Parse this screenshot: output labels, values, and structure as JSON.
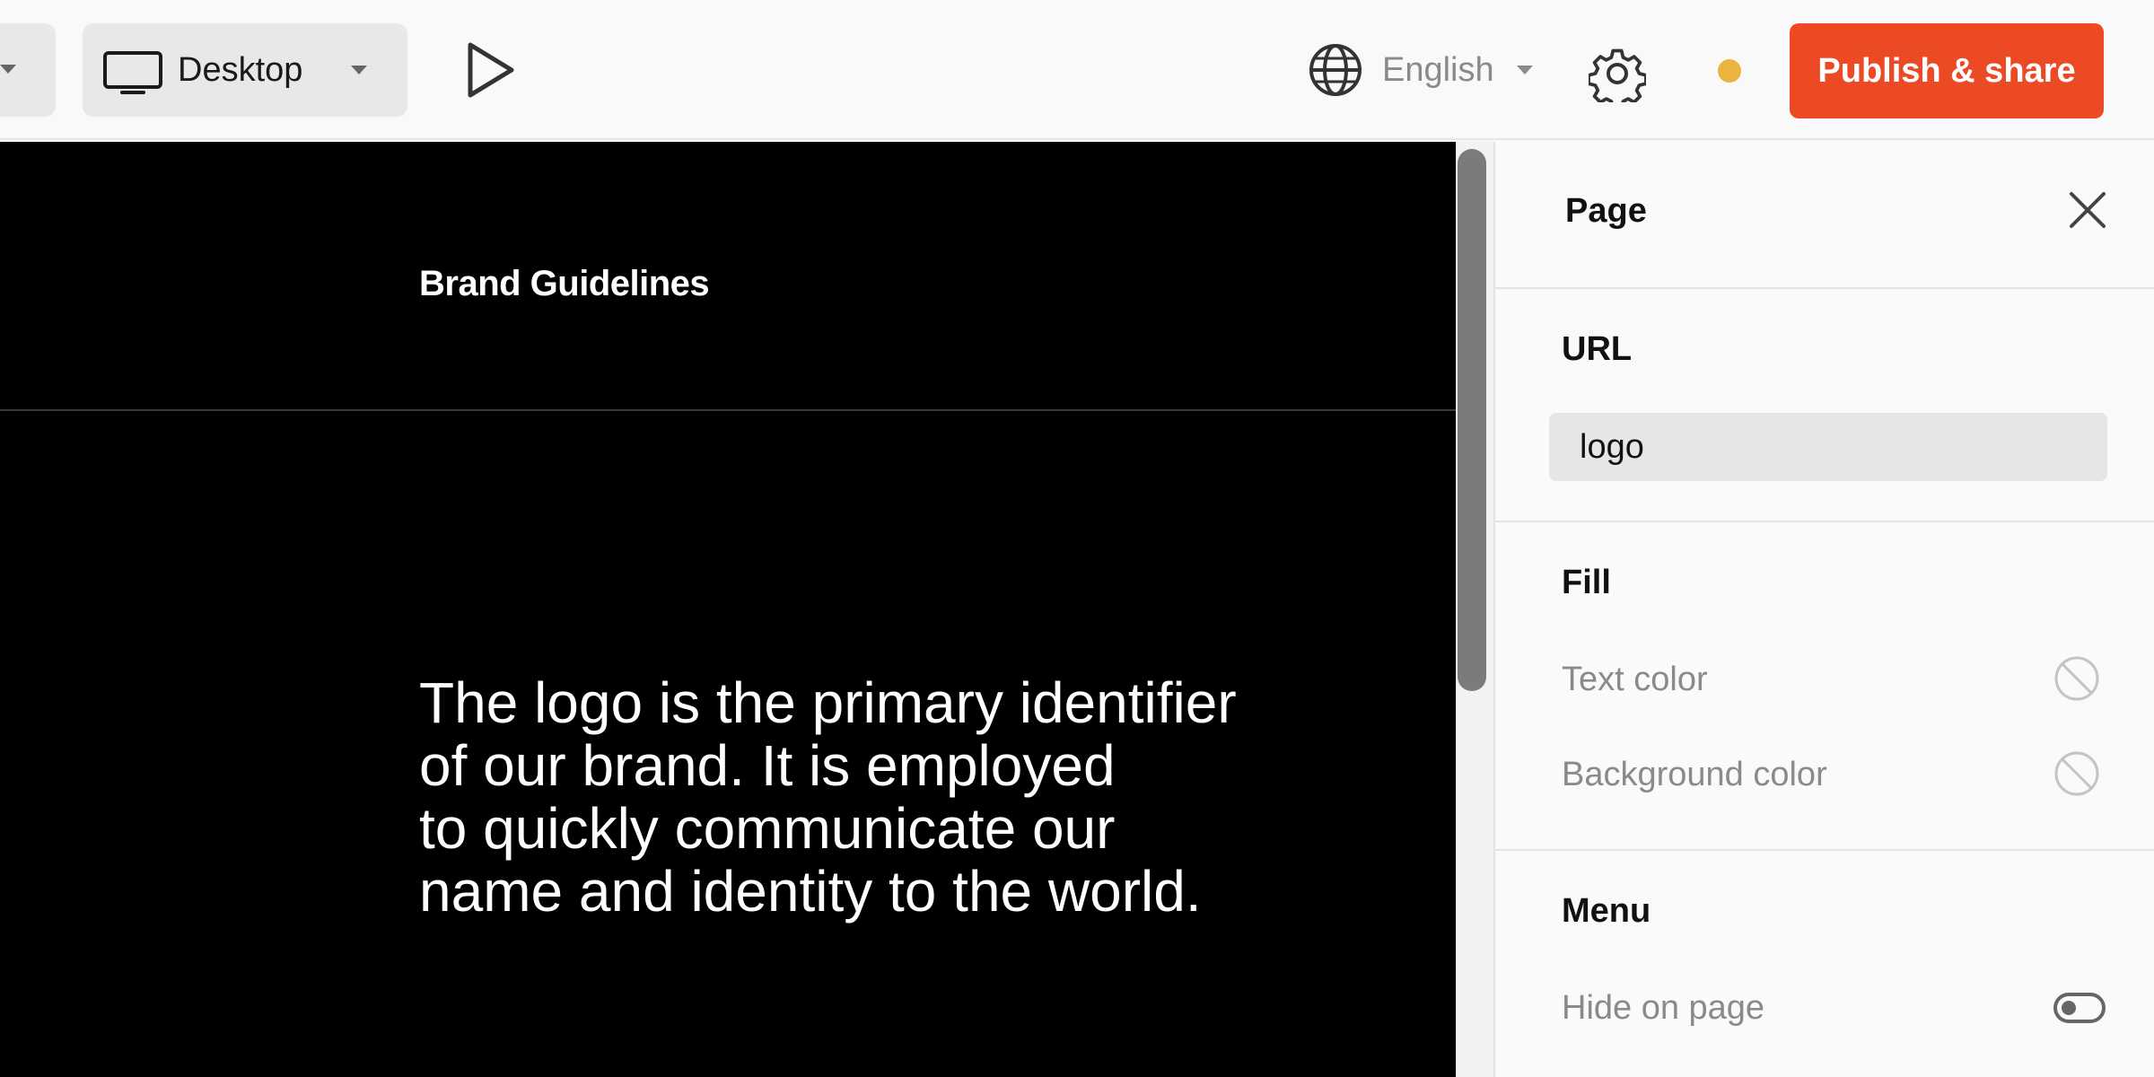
{
  "toolbar": {
    "device": {
      "label": "Desktop",
      "icon": "monitor-icon"
    },
    "play": {
      "icon": "play-icon"
    },
    "language": {
      "label": "English",
      "icon": "globe-icon"
    },
    "settings": {
      "icon": "gear-icon"
    },
    "status": {
      "color": "#EBB43C"
    },
    "publish": {
      "label": "Publish & share",
      "color": "#EC4A25"
    }
  },
  "canvas": {
    "site_title": "Brand Guidelines",
    "body_lines": [
      "The logo is the primary identifier",
      "of our brand. It is employed",
      "to quickly communicate our",
      "name and identity to the world."
    ]
  },
  "panel": {
    "title": "Page",
    "url": {
      "heading": "URL",
      "value": "logo"
    },
    "fill": {
      "heading": "Fill",
      "text_color_label": "Text color",
      "background_color_label": "Background color"
    },
    "menu": {
      "heading": "Menu",
      "hide_on_page_label": "Hide on page",
      "hide_on_page": false
    }
  }
}
